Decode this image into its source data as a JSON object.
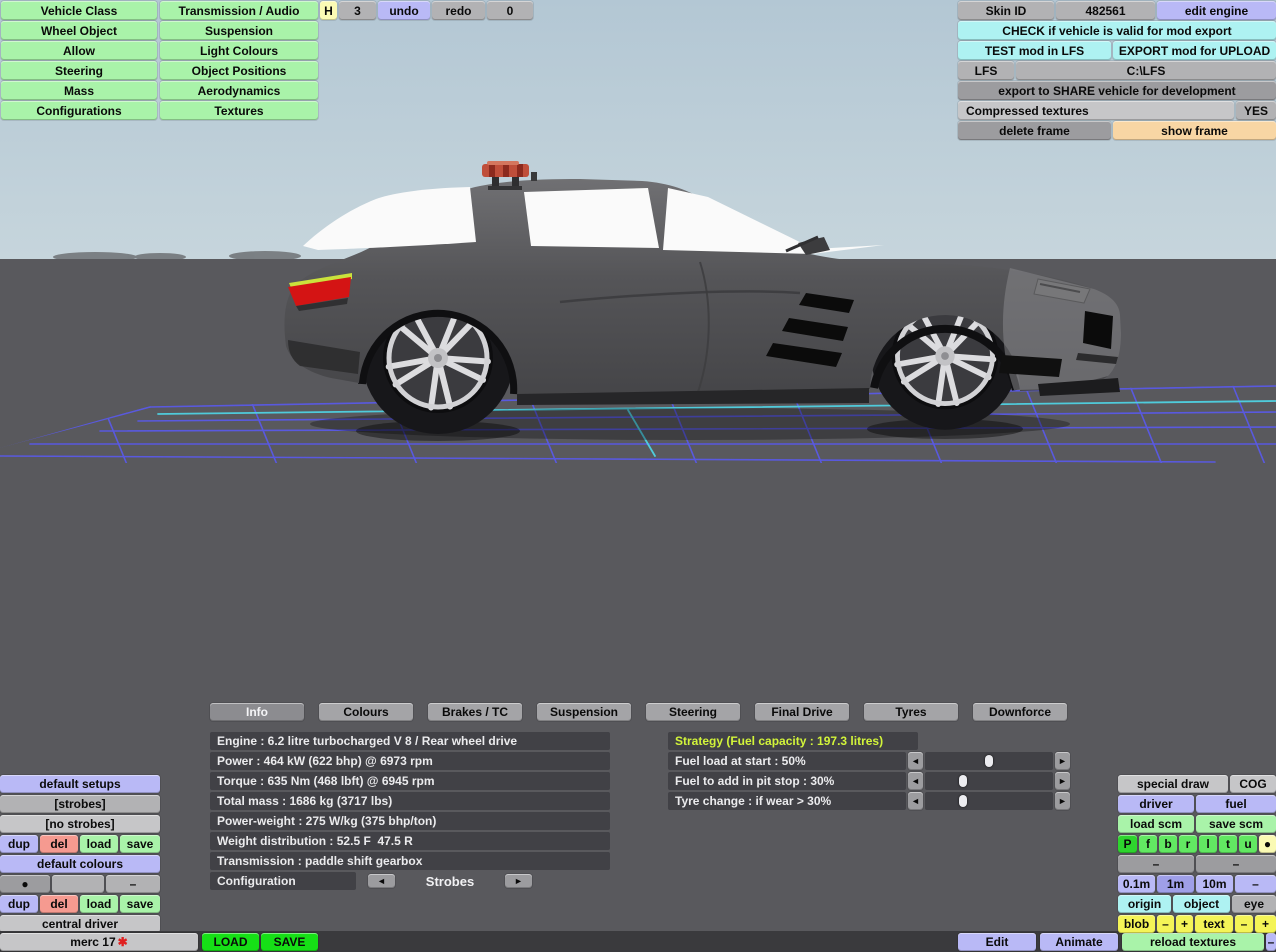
{
  "menu": {
    "col1": [
      "Vehicle Class",
      "Wheel Object",
      "Allow",
      "Steering",
      "Mass",
      "Configurations"
    ],
    "col2": [
      "Transmission / Audio",
      "Suspension",
      "Light Colours",
      "Object Positions",
      "Aerodynamics",
      "Textures"
    ]
  },
  "history": {
    "hotkey": "H",
    "count": "3",
    "undo": "undo",
    "redo": "redo",
    "extra": "0"
  },
  "export_panel": {
    "skin_id_label": "Skin ID",
    "skin_id_value": "482561",
    "edit_engine": "edit engine",
    "check": "CHECK if vehicle is valid for mod export",
    "test": "TEST mod in LFS",
    "export_upload": "EXPORT mod for UPLOAD",
    "lfs": "LFS",
    "lfs_path": "C:\\LFS",
    "share": "export to SHARE vehicle for development",
    "compressed": "Compressed textures",
    "compressed_value": "YES",
    "delete_frame": "delete frame",
    "show_frame": "show frame"
  },
  "tabs": {
    "items": [
      "Info",
      "Colours",
      "Brakes / TC",
      "Suspension",
      "Steering",
      "Final Drive",
      "Tyres",
      "Downforce"
    ],
    "active": "Info"
  },
  "info": {
    "rows": [
      "Engine : 6.2 litre turbocharged V 8 / Rear wheel drive",
      "Power : 464 kW (622 bhp) @ 6973 rpm",
      "Torque : 635 Nm (468 lbft) @ 6945 rpm",
      "Total mass : 1686 kg (3717 lbs)",
      "Power-weight : 275 W/kg (375 bhp/ton)",
      "Weight distribution : 52.5 F  47.5 R",
      "Transmission : paddle shift gearbox"
    ]
  },
  "configuration": {
    "label": "Configuration",
    "value": "Strobes",
    "prev": "◄",
    "next": "►"
  },
  "strategy": {
    "title": "Strategy (Fuel capacity : 197.3 litres)",
    "rows": [
      {
        "label": "Fuel load at start : 50%",
        "percent": 50,
        "prev": "◄",
        "next": "►"
      },
      {
        "label": "Fuel to add in pit stop : 30%",
        "percent": 30,
        "prev": "◄",
        "next": "►"
      },
      {
        "label": "Tyre change : if wear > 30%",
        "percent": 30,
        "prev": "◄",
        "next": "►"
      }
    ]
  },
  "setups_panel": {
    "default_setups": "default setups",
    "slot1": "[strobes]",
    "slot2": "[no strobes]",
    "ops": [
      "dup",
      "del",
      "load",
      "save"
    ],
    "default_colours": "default colours",
    "dot": "●",
    "dash": "–",
    "central_driver": "central driver"
  },
  "file_bar": {
    "vehicle_name": "merc 17",
    "modified_marker": "✱",
    "load": "LOAD",
    "save": "SAVE",
    "edit": "Edit",
    "animate": "Animate",
    "reload_textures": "reload textures",
    "dash": "–"
  },
  "view_panel": {
    "special_draw": "special draw",
    "cog": "COG",
    "driver": "driver",
    "fuel": "fuel",
    "load_scm": "load scm",
    "save_scm": "save scm",
    "draw_flags": [
      "P",
      "f",
      "b",
      "r",
      "l",
      "t",
      "u"
    ],
    "draw_dot": "●",
    "dash": "–",
    "grid_steps": [
      "0.1m",
      "1m",
      "10m"
    ],
    "active_step": "1m",
    "origin": "origin",
    "object": "object",
    "eye": "eye",
    "blob": "blob",
    "minus": "–",
    "plus": "+",
    "text": "text"
  },
  "colors": {
    "accent_green": "#a9f3a9",
    "accent_purple": "#b9b9f6",
    "accent_cyan": "#aef2f2",
    "accent_yellow": "#f4f457",
    "bright_green": "#16e016",
    "salmon": "#f59a90",
    "peach": "#f8d6a4",
    "strategy_text": "#d2f43a",
    "sky_top": "#b3c7d4",
    "sky_bottom": "#c4d3db",
    "ground": "#59595d",
    "grid_purple": "#5a5ae6",
    "grid_cyan": "#4fd2e2"
  }
}
